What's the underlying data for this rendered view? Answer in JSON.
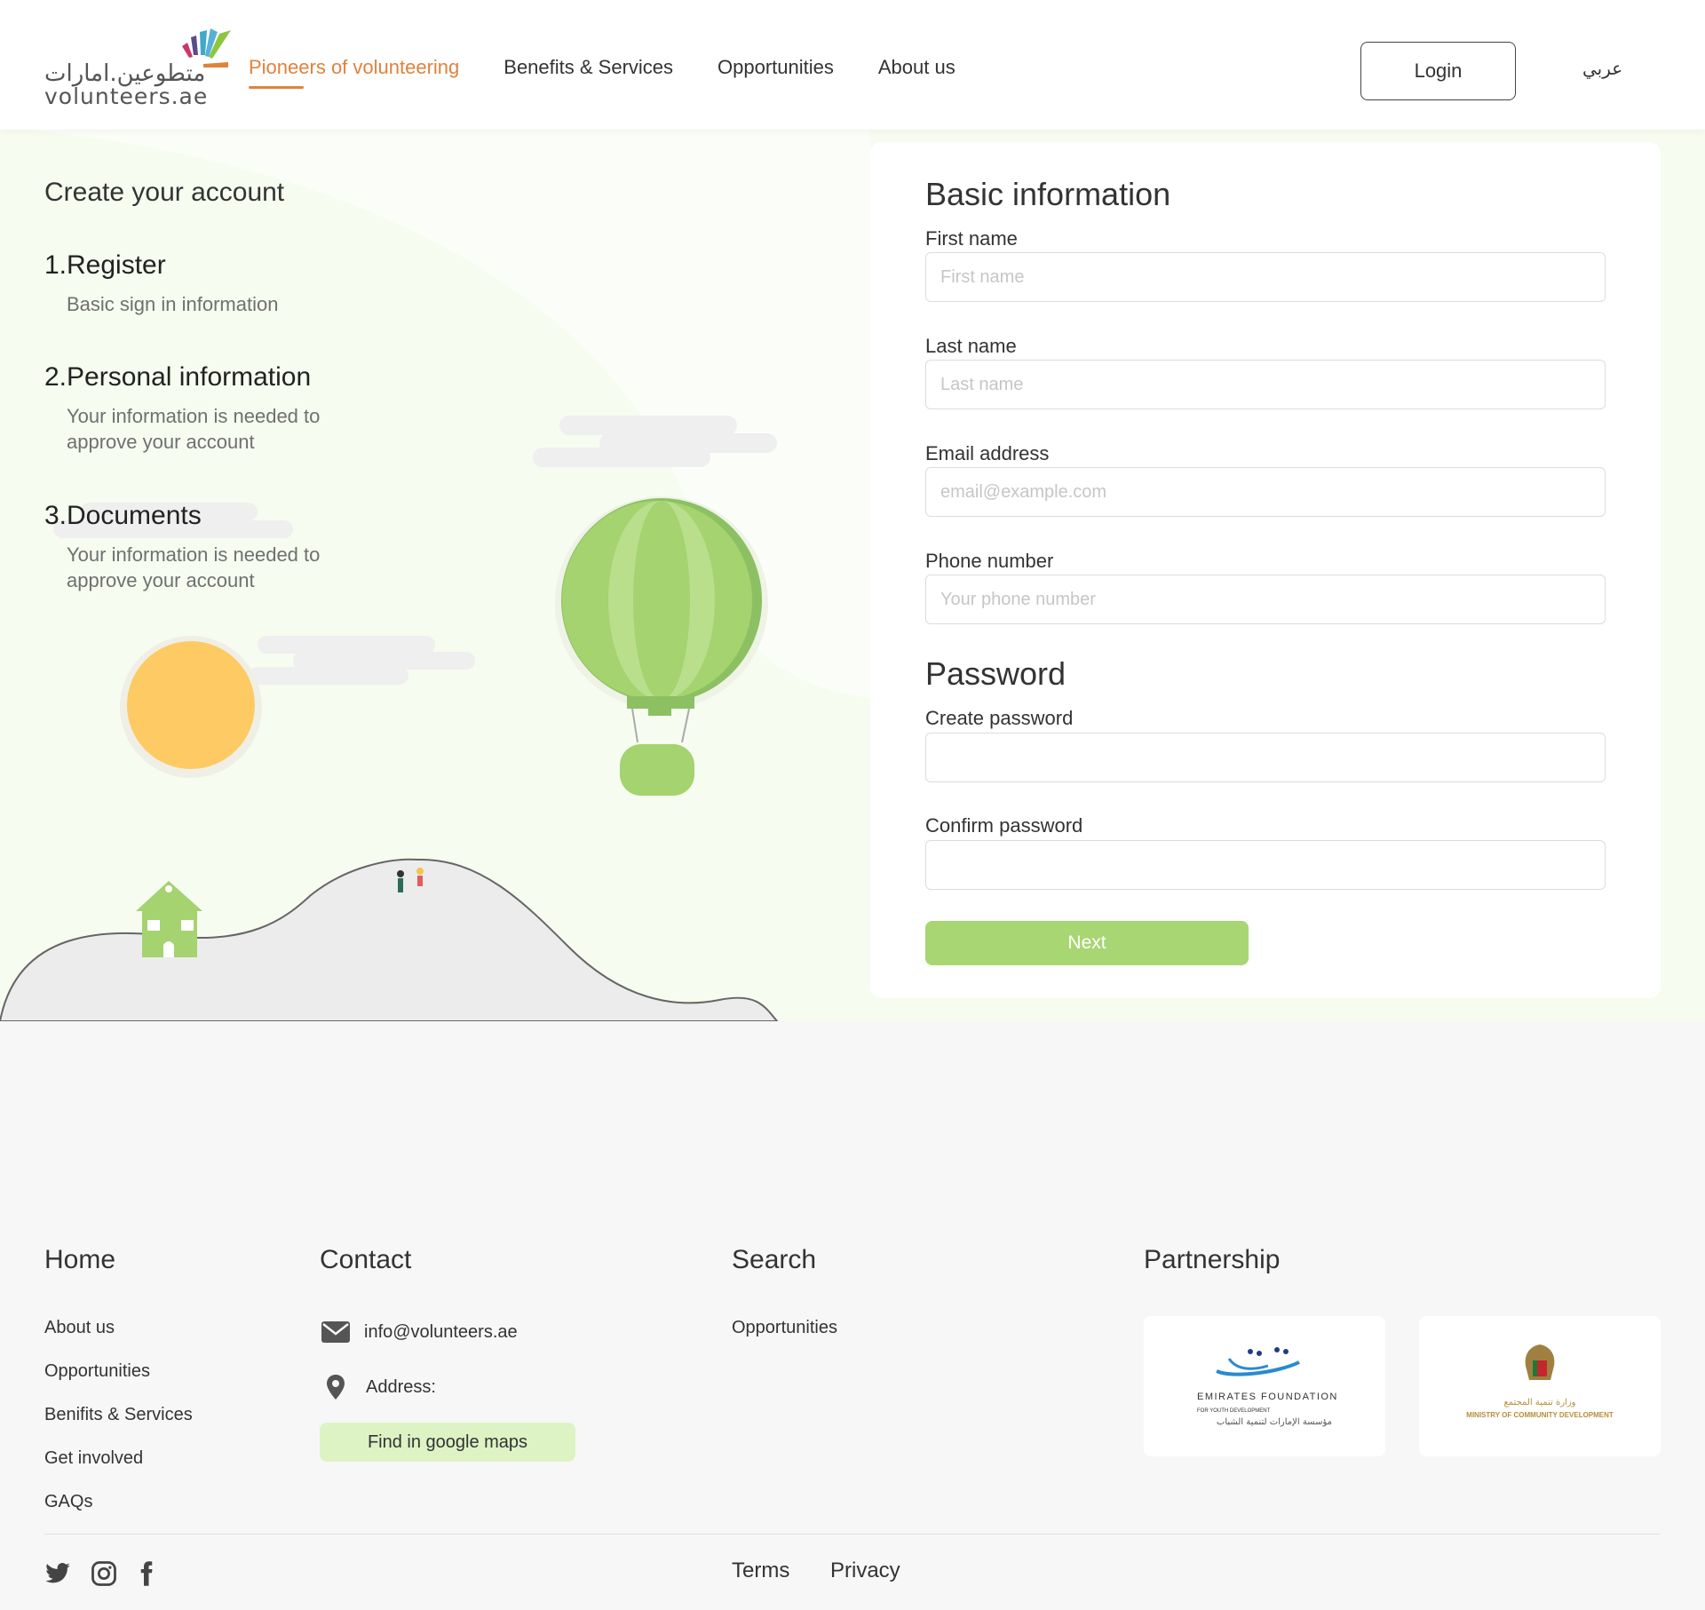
{
  "header": {
    "logo_ar": "متطوعين.امارات",
    "logo_en": "volunteers.ae",
    "nav": [
      {
        "label": "Pioneers of volunteering",
        "active": true
      },
      {
        "label": "Benefits & Services",
        "active": false
      },
      {
        "label": "Opportunities",
        "active": false
      },
      {
        "label": "About us",
        "active": false
      }
    ],
    "login_label": "Login",
    "lang_label": "عربي"
  },
  "steps": {
    "title": "Create your account",
    "items": [
      {
        "title": "1.Register",
        "desc": "Basic sign in information"
      },
      {
        "title": "2.Personal information",
        "desc": "Your information is needed to approve your account"
      },
      {
        "title": "3.Documents",
        "desc": "Your information is needed to approve your account"
      }
    ]
  },
  "form": {
    "basic_title": "Basic information",
    "first_name_label": "First name",
    "first_name_placeholder": "First name",
    "first_name_value": "",
    "last_name_label": "Last name",
    "last_name_placeholder": "Last name",
    "last_name_value": "",
    "email_label": "Email address",
    "email_placeholder": "email@example.com",
    "email_value": "",
    "phone_label": "Phone number",
    "phone_placeholder": "Your phone number",
    "phone_value": "",
    "password_title": "Password",
    "create_password_label": "Create password",
    "create_password_value": "",
    "confirm_password_label": "Confirm password",
    "confirm_password_value": "",
    "next_label": "Next"
  },
  "footer": {
    "home": {
      "title": "Home",
      "links": [
        "About us",
        "Opportunities",
        "Benifits & Services",
        "Get involved",
        "GAQs"
      ]
    },
    "contact": {
      "title": "Contact",
      "email": "info@volunteers.ae",
      "address_label": "Address:",
      "maps_label": "Find in google maps"
    },
    "search": {
      "title": "Search",
      "links": [
        "Opportunities"
      ]
    },
    "partnership": {
      "title": "Partnership",
      "partner1_en": "EMIRATES FOUNDATION",
      "partner1_small": "FOR YOUTH DEVELOPMENT",
      "partner1_ar": "مؤسسة الإمارات لتنمية الشباب",
      "partner2_ar": "وزارة تنمية المجتمع",
      "partner2_en": "MINISTRY OF COMMUNITY DEVELOPMENT"
    },
    "bottom_links": [
      "Terms",
      "Privacy"
    ]
  },
  "colors": {
    "accent": "#e0823d",
    "green": "#a8d672",
    "hero_bg": "#f6fcf0",
    "footer_bg": "#f7f7f7",
    "sun": "#fdca64"
  },
  "icons": [
    "twitter-icon",
    "instagram-icon",
    "facebook-icon",
    "mail-icon",
    "location-pin-icon"
  ]
}
